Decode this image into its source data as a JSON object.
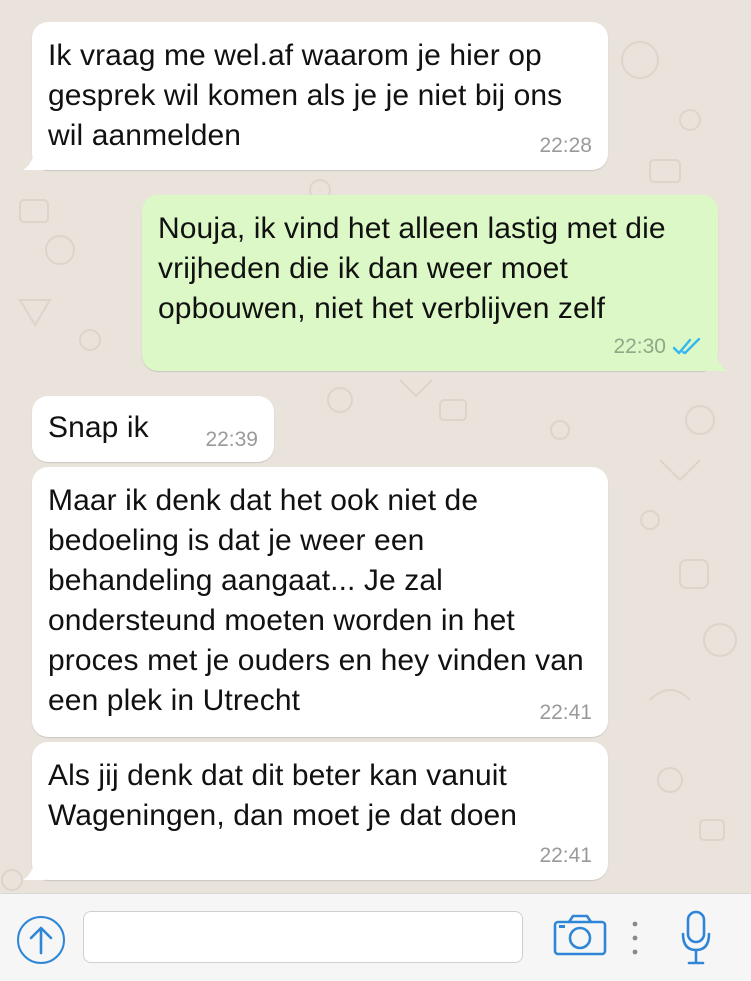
{
  "messages": [
    {
      "direction": "incoming",
      "text": "Ik vraag me wel.af waarom je hier op gesprek wil komen als je je niet bij ons wil aanmelden",
      "time": "22:28"
    },
    {
      "direction": "outgoing",
      "text": "Nouja, ik vind het alleen lastig met die vrijheden die ik dan weer moet opbouwen, niet het verblijven zelf",
      "time": "22:30",
      "status": "read-double-check"
    },
    {
      "direction": "incoming",
      "text": "Snap ik",
      "time": "22:39"
    },
    {
      "direction": "incoming",
      "text": "Maar ik denk dat het ook niet de bedoeling is dat je weer een behandeling aangaat... Je zal ondersteund moeten worden in het proces met je ouders en hey vinden van een plek in Utrecht",
      "time": "22:41"
    },
    {
      "direction": "incoming",
      "text": "Als jij denk dat dit beter kan vanuit Wageningen, dan moet je dat doen",
      "time": "22:41"
    }
  ],
  "input_bar": {
    "placeholder": "",
    "value": "",
    "icons": [
      "upload-arrow-icon",
      "camera-icon",
      "more-dots-icon",
      "microphone-icon"
    ]
  },
  "colors": {
    "incoming_bubble": "#ffffff",
    "outgoing_bubble": "#dcf8c6",
    "read_ticks": "#34b7f1",
    "accent": "#2f86d6",
    "chat_background": "#e9e3dc"
  }
}
